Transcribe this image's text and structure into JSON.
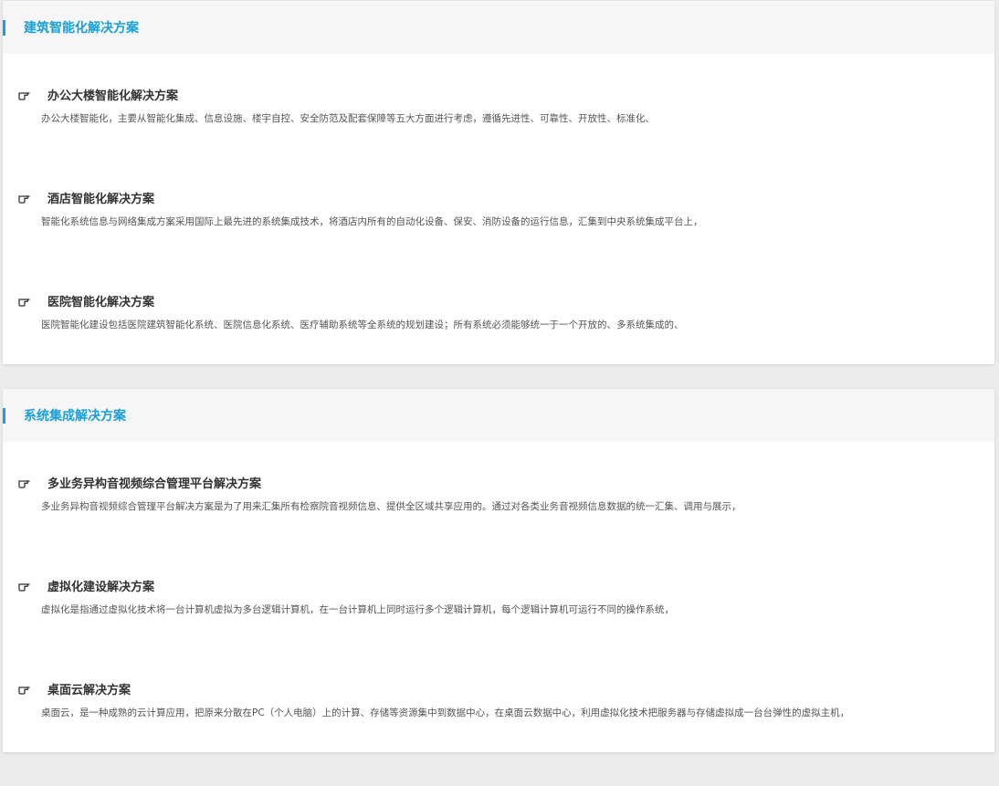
{
  "sections": [
    {
      "title": "建筑智能化解决方案",
      "items": [
        {
          "title": "办公大楼智能化解决方案",
          "description": "办公大楼智能化，主要从智能化集成、信息设施、楼宇自控、安全防范及配套保障等五大方面进行考虑，遵循先进性、可靠性、开放性、标准化、"
        },
        {
          "title": "酒店智能化解决方案",
          "description": "智能化系统信息与网络集成方案采用国际上最先进的系统集成技术，将酒店内所有的自动化设备、保安、消防设备的运行信息，汇集到中央系统集成平台上，"
        },
        {
          "title": "医院智能化解决方案",
          "description": "医院智能化建设包括医院建筑智能化系统、医院信息化系统、医疗辅助系统等全系统的规划建设；所有系统必须能够统一于一个开放的、多系统集成的、"
        }
      ]
    },
    {
      "title": "系统集成解决方案",
      "items": [
        {
          "title": "多业务异构音视频综合管理平台解决方案",
          "description": "多业务异构音视频综合管理平台解决方案是为了用来汇集所有检察院音视频信息、提供全区域共享应用的。通过对各类业务音视频信息数据的统一汇集、调用与展示，"
        },
        {
          "title": "虚拟化建设解决方案",
          "description": "虚拟化是指通过虚拟化技术将一台计算机虚拟为多台逻辑计算机，在一台计算机上同时运行多个逻辑计算机，每个逻辑计算机可运行不同的操作系统，"
        },
        {
          "title": "桌面云解决方案",
          "description": "桌面云，是一种成熟的云计算应用，把原来分散在PC（个人电脑）上的计算、存储等资源集中到数据中心，在桌面云数据中心，利用虚拟化技术把服务器与存储虚拟成一台台弹性的虚拟主机，"
        }
      ]
    }
  ],
  "icons": {
    "bullet": "pointing-hand-icon"
  },
  "colors": {
    "accent": "#1a9fd9",
    "title_text": "#333333",
    "body_text": "#555555",
    "header_bg": "#f6f6f6",
    "page_bg": "#ececec"
  }
}
